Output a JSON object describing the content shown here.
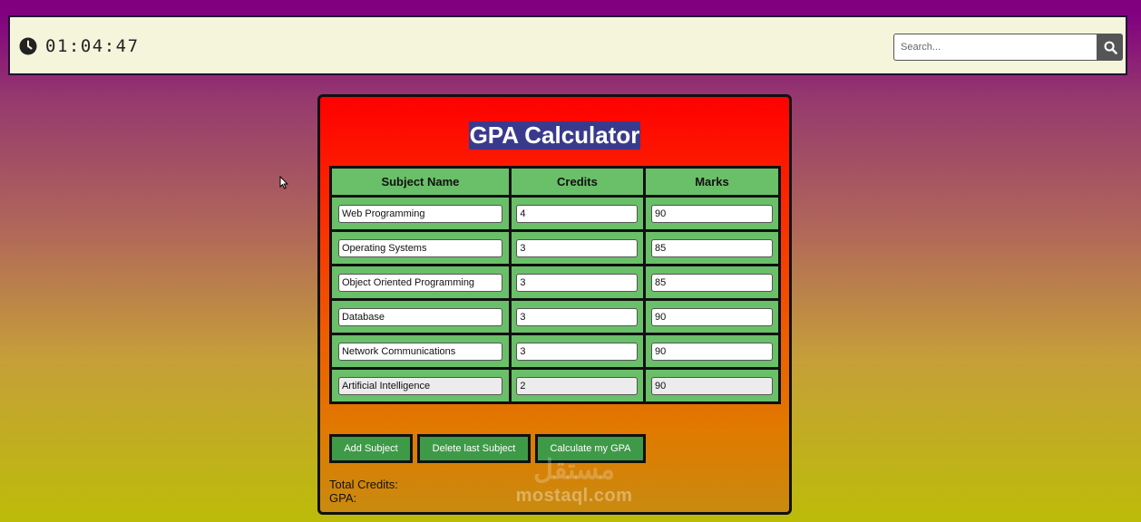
{
  "header": {
    "clock": "01:04:47",
    "search": {
      "placeholder": "Search...",
      "value": ""
    }
  },
  "calculator": {
    "title": "GPA Calculator",
    "columns": [
      "Subject Name",
      "Credits",
      "Marks"
    ],
    "rows": [
      {
        "subject": "Web Programming",
        "credits": "4",
        "marks": "90"
      },
      {
        "subject": "Operating Systems",
        "credits": "3",
        "marks": "85"
      },
      {
        "subject": "Object Oriented Programming",
        "credits": "3",
        "marks": "85"
      },
      {
        "subject": "Database",
        "credits": "3",
        "marks": "90"
      },
      {
        "subject": "Network Communications",
        "credits": "3",
        "marks": "90"
      },
      {
        "subject": "Artificial Intelligence",
        "credits": "2",
        "marks": "90"
      }
    ],
    "buttons": {
      "add": "Add Subject",
      "delete": "Delete last Subject",
      "calculate": "Calculate my GPA"
    },
    "total_credits_label": "Total Credits:",
    "gpa_label": "GPA:"
  },
  "watermark": {
    "arabic": "مستقل",
    "latin": "mostaql.com"
  },
  "colors": {
    "header_bg": "#f5f5dc",
    "card_top": "#ff0000",
    "table_cell": "#6abf69",
    "button": "#3e9a47",
    "title_highlight": "#3a3a8c"
  },
  "icons": [
    "clock-icon",
    "search-icon"
  ]
}
